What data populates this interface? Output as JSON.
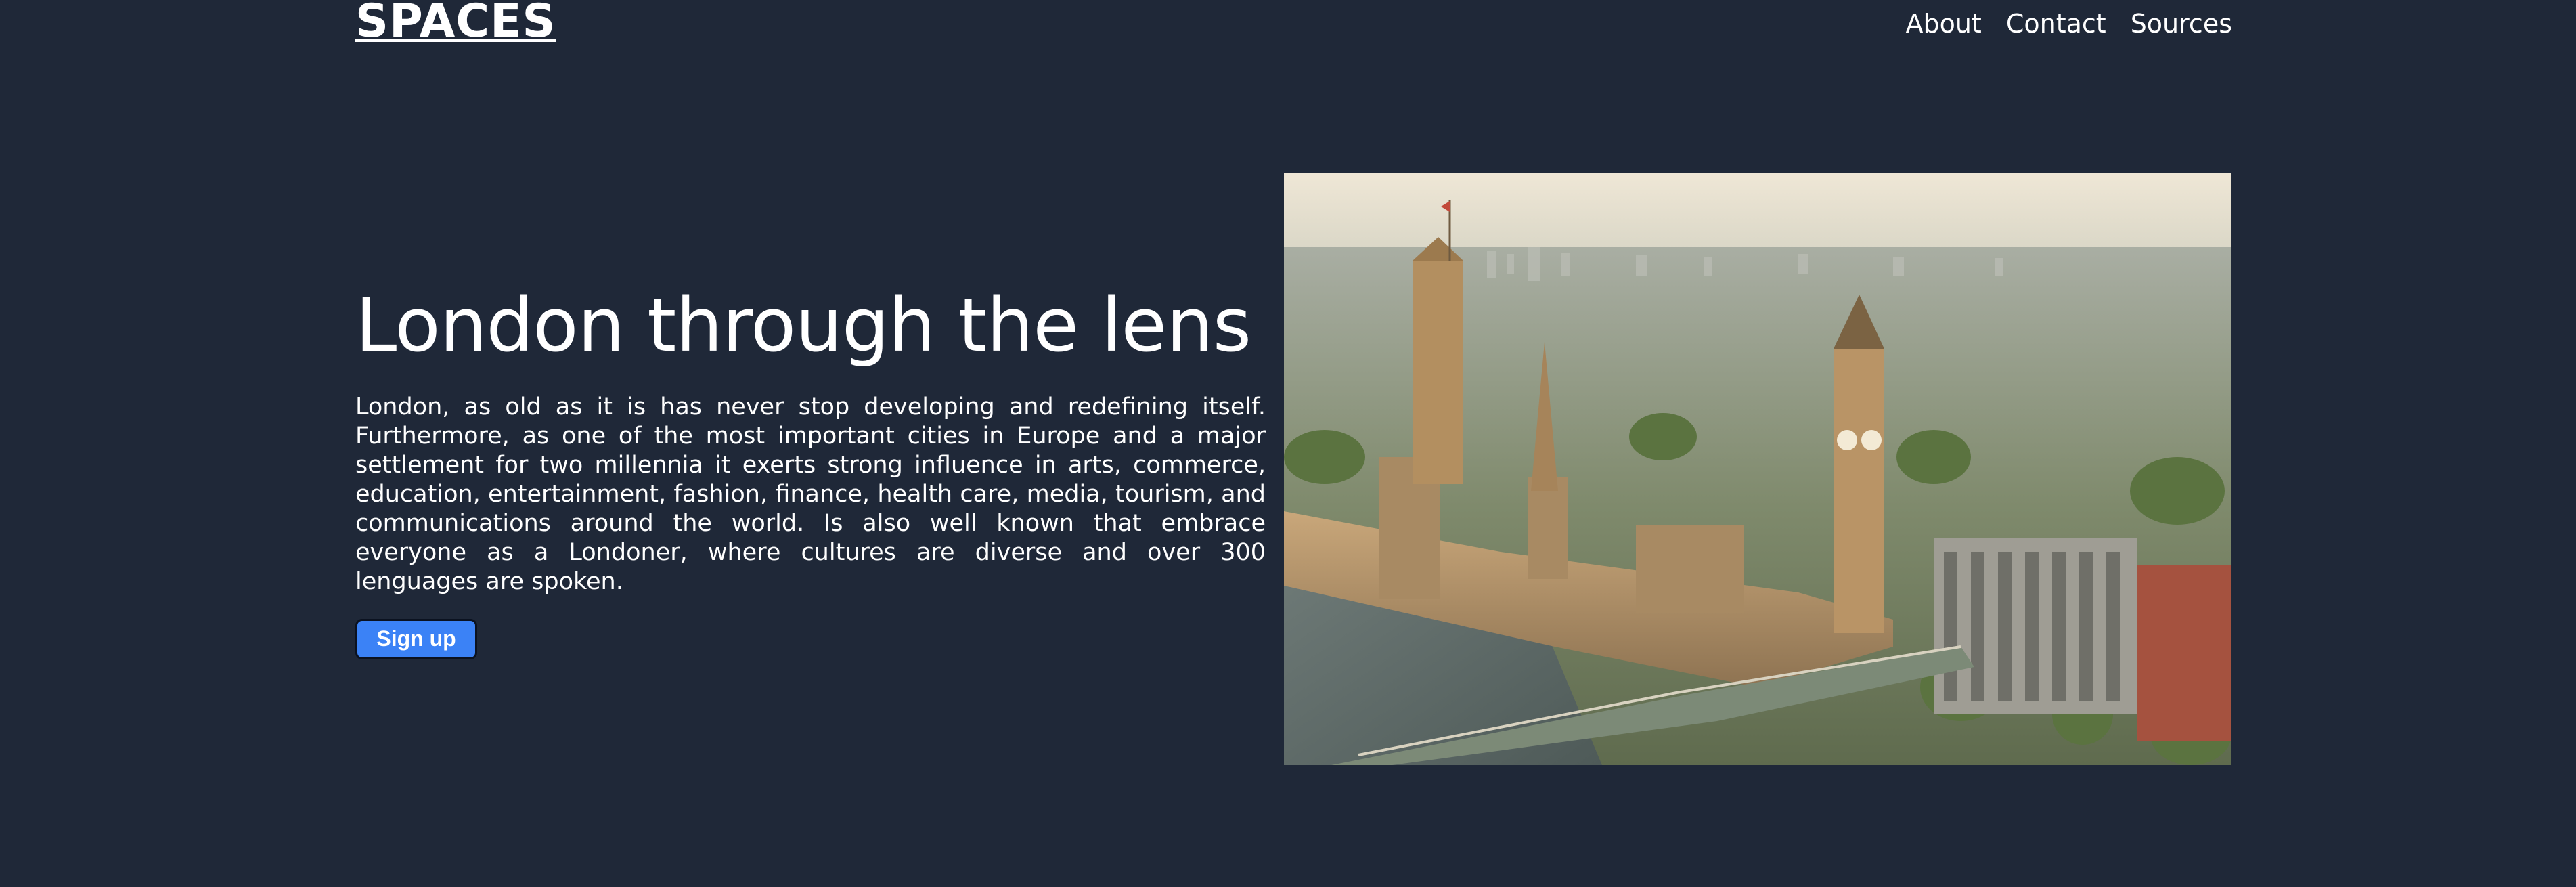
{
  "header": {
    "logo": "SPACES",
    "nav": [
      {
        "label": "About"
      },
      {
        "label": "Contact"
      },
      {
        "label": "Sources"
      }
    ]
  },
  "hero": {
    "title": "London through the lens",
    "body": "London, as old as it is has never stop developing and redefining itself. Furthermore, as one of the most important cities in Europe and a major settlement for two millennia it exerts strong influence in arts, commerce, education, entertainment, fashion, finance, health care, media, tourism, and communications around the world. Is also well known that embrace everyone as a Londoner, where cultures are diverse and over 300 lenguages are spoken.",
    "cta_label": "Sign up"
  },
  "colors": {
    "background": "#1f2838",
    "button": "#3b82f6",
    "text": "#ffffff"
  }
}
